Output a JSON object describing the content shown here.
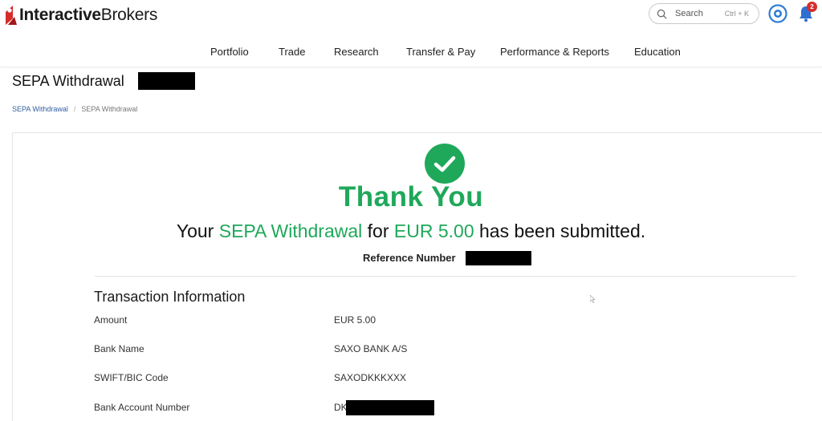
{
  "brand": {
    "name_part1": "Interactive",
    "name_part2": "Brokers",
    "accent": "#d62c2c"
  },
  "header": {
    "search": {
      "label": "Search",
      "shortcut": "Ctrl + K"
    },
    "notifications": {
      "count": "2"
    }
  },
  "nav": {
    "items": [
      {
        "label": "Portfolio"
      },
      {
        "label": "Trade"
      },
      {
        "label": "Research"
      },
      {
        "label": "Transfer & Pay"
      },
      {
        "label": "Performance & Reports"
      },
      {
        "label": "Education"
      }
    ]
  },
  "page": {
    "title": "SEPA Withdrawal",
    "breadcrumb": [
      "SEPA Withdrawal",
      "SEPA Withdrawal"
    ]
  },
  "confirmation": {
    "heading": "Thank You",
    "message_prefix": "Your",
    "message_type": "SEPA Withdrawal",
    "message_mid": "for",
    "message_amount": "EUR 5.00",
    "message_suffix": "has been submitted.",
    "reference_label": "Reference Number",
    "success_color": "#1fa85a"
  },
  "transaction": {
    "title": "Transaction Information",
    "rows": [
      {
        "label": "Amount",
        "value": "EUR 5.00"
      },
      {
        "label": "Bank Name",
        "value": "SAXO BANK A/S"
      },
      {
        "label": "SWIFT/BIC Code",
        "value": "SAXODKKKXXX"
      },
      {
        "label": "Bank Account Number",
        "value": "DK"
      }
    ]
  }
}
